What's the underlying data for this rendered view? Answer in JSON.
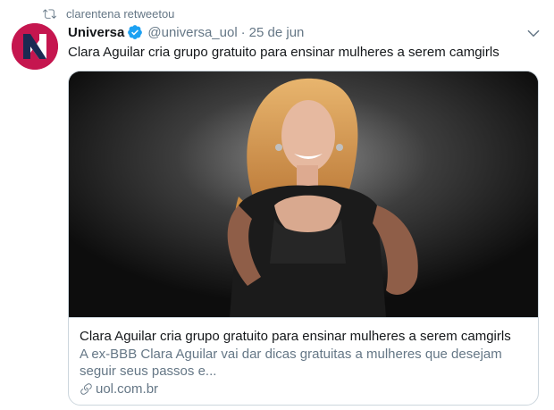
{
  "retweet": {
    "icon": "retweet-icon",
    "text": "clarentena retweetou"
  },
  "author": {
    "avatar_icon": "universa-logo-icon",
    "display_name": "Universa",
    "verified_icon": "verified-badge-icon",
    "handle": "@universa_uol",
    "separator": "·",
    "date": "25 de jun"
  },
  "tweet": {
    "text": "Clara Aguilar cria grupo gratuito para ensinar mulheres a serem camgirls",
    "menu_icon": "chevron-down-icon"
  },
  "card": {
    "image_icon": "card-photo",
    "title": "Clara Aguilar cria grupo gratuito para ensinar mulheres a serem camgirls",
    "description": "A ex-BBB Clara Aguilar vai dar dicas gratuitas a mulheres que desejam seguir seus passos e...",
    "domain_icon": "link-icon",
    "domain": "uol.com.br"
  },
  "colors": {
    "avatar_bg": "#c5164f",
    "verified_blue": "#1da1f2",
    "secondary_text": "#657786",
    "border": "#ccd6dd"
  }
}
